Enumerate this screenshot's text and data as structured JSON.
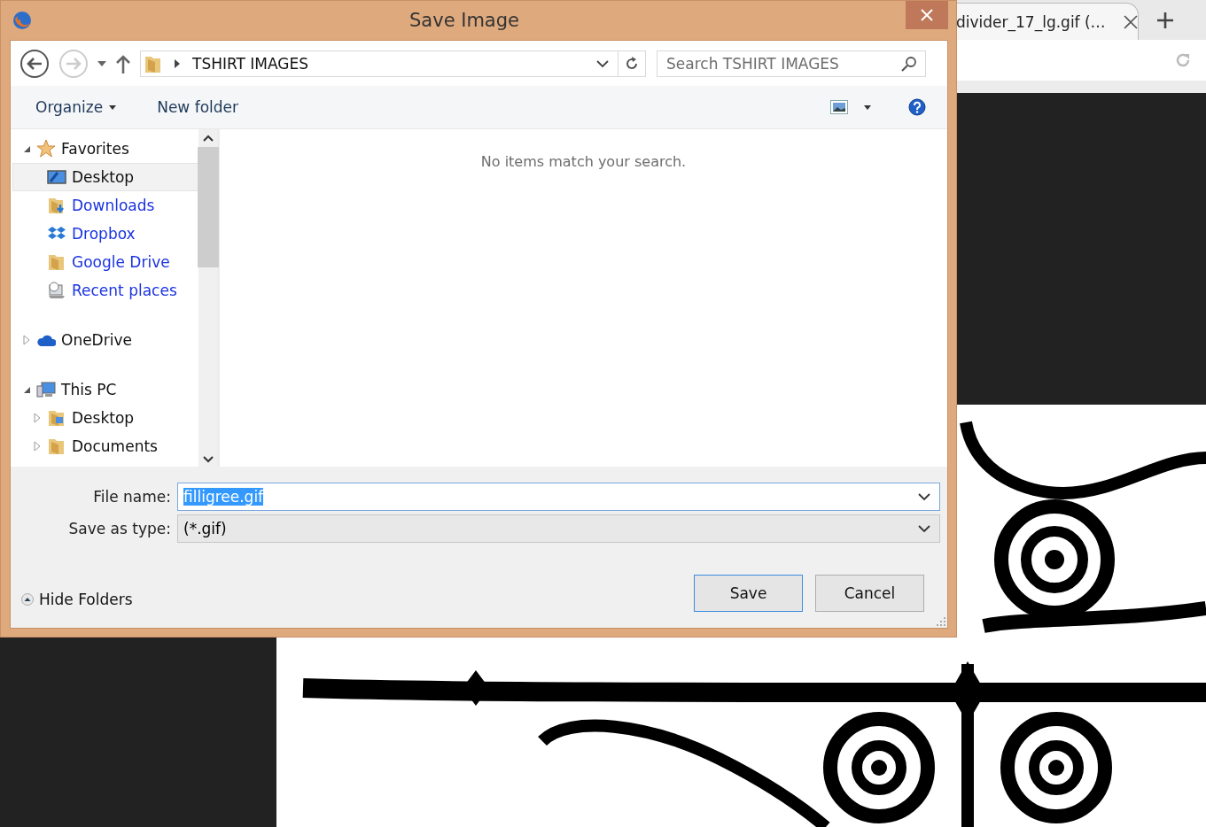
{
  "browser": {
    "tab": {
      "title": "divider_17_lg.gif (…"
    }
  },
  "window": {
    "title": "Save Image"
  },
  "nav": {
    "path": "TSHIRT IMAGES",
    "search": {
      "placeholder": "Search TSHIRT IMAGES"
    }
  },
  "toolbar": {
    "organize": "Organize",
    "new_folder": "New folder"
  },
  "tree": [
    {
      "label": "Favorites",
      "kind": "favorites",
      "expanded": true,
      "selected": false,
      "children": [
        {
          "label": "Desktop",
          "selected": true
        },
        {
          "label": "Downloads",
          "selected": false
        },
        {
          "label": "Dropbox",
          "selected": false
        },
        {
          "label": "Google Drive",
          "selected": false
        },
        {
          "label": "Recent places",
          "selected": false
        }
      ]
    },
    {
      "label": "OneDrive",
      "kind": "cloud",
      "expanded": false,
      "selected": false
    },
    {
      "label": "This PC",
      "kind": "computer",
      "expanded": true,
      "selected": false,
      "children": [
        {
          "label": "Desktop",
          "expanded": false,
          "selected": false
        },
        {
          "label": "Documents",
          "expanded": false,
          "selected": false
        }
      ]
    }
  ],
  "content": {
    "message": "No items match your search."
  },
  "fields": [
    {
      "label": "File name:",
      "value": "filligree.gif",
      "kind": "editable",
      "text_selected": true
    },
    {
      "label": "Save as type:",
      "value": "(*.gif)",
      "kind": "dropdown",
      "text_selected": false
    }
  ],
  "hide_folders": "Hide Folders",
  "buttons": [
    {
      "label": "Save",
      "default": true
    },
    {
      "label": "Cancel",
      "default": false
    }
  ]
}
